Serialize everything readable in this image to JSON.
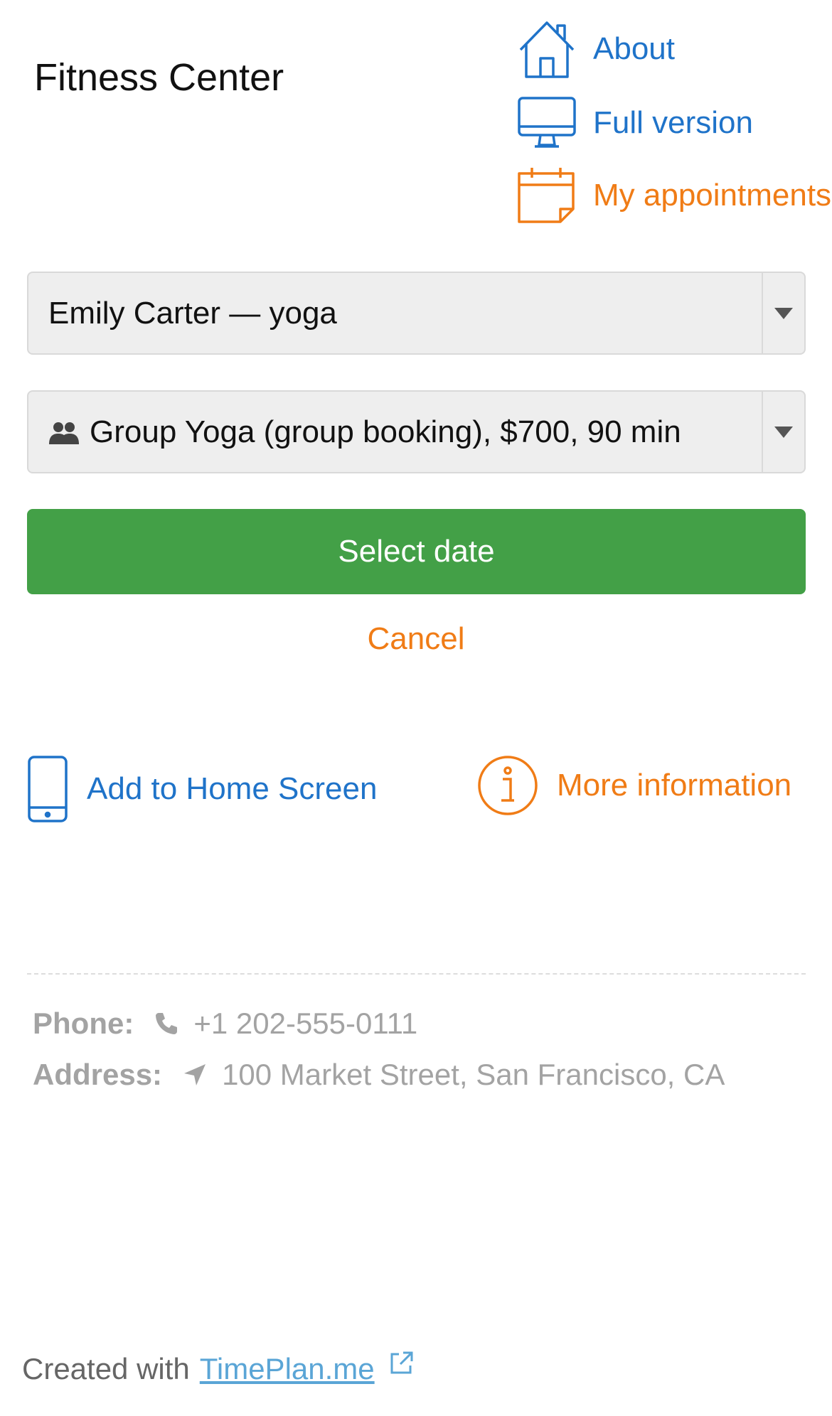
{
  "header": {
    "title": "Fitness Center",
    "links": {
      "about": {
        "label": "About",
        "icon": "house-icon"
      },
      "full_version": {
        "label": "Full version",
        "icon": "monitor-icon"
      },
      "appointments": {
        "label": "My appointments",
        "icon": "calendar-icon"
      }
    }
  },
  "form": {
    "specialist_select": {
      "value": "Emily Carter — yoga"
    },
    "service_select": {
      "value": "Group Yoga (group booking), $700, 90 min",
      "icon": "group-people-icon"
    },
    "submit_label": "Select date",
    "cancel_label": "Cancel"
  },
  "actions": {
    "add_home": {
      "label": "Add to Home Screen",
      "icon": "phone-icon"
    },
    "more_info": {
      "label": "More information",
      "icon": "info-icon"
    }
  },
  "contacts": {
    "phone_label": "Phone:",
    "phone_value": "+1 202-555-0111",
    "address_label": "Address:",
    "address_value": "100 Market Street, San Francisco, CA"
  },
  "footer": {
    "prefix": "Created with",
    "link_label": "TimePlan.me",
    "icon": "external-link-icon"
  },
  "colors": {
    "blue": "#1f73c9",
    "orange": "#f07c16",
    "green": "#43a047",
    "muted": "#a3a3a3"
  }
}
